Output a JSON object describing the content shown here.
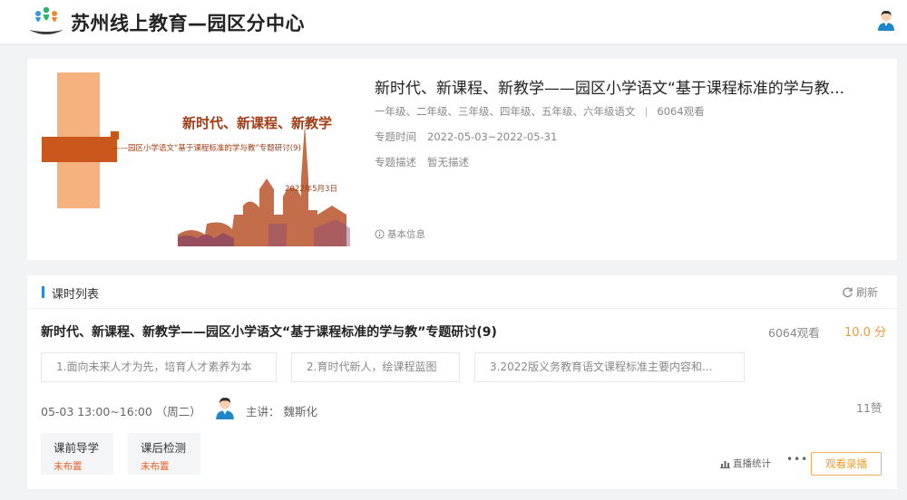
{
  "header": {
    "site_title": "苏州线上教育—园区分中心"
  },
  "topic": {
    "banner": {
      "title": "新时代、新课程、新教学",
      "subtitle": "——园区小学语文“基于课程标准的学与教”专题研讨(9)",
      "date": "2022年5月3日"
    },
    "title": "新时代、新课程、新教学——园区小学语文“基于课程标准的学与教...",
    "grades": "一年级、二年级、三年级、四年级、五年级、六年级语文",
    "separator": "|",
    "views": "6064观看",
    "time_label": "专题时间",
    "time_value": "2022-05-03~2022-05-31",
    "desc_label": "专题描述",
    "desc_value": "暂无描述",
    "basic_info": "基本信息"
  },
  "lesson_list": {
    "title": "课时列表",
    "refresh": "刷新",
    "lesson": {
      "title": "新时代、新课程、新教学——园区小学语文“基于课程标准的学与教”专题研讨(9)",
      "views": "6064观看",
      "score": "10.0 分",
      "chapters": [
        "1.面向未来人才为先，培育人才素养为本",
        "2.育时代新人，绘课程蓝图",
        "3.2022版义务教育语文课程标准主要内容和..."
      ],
      "time": "05-03 13:00~16:00 （周二）",
      "teacher": "主讲：  魏斯化",
      "likes": "11赞",
      "tasks": [
        {
          "name": "课前导学",
          "status": "未布置"
        },
        {
          "name": "课后检测",
          "status": "未布置"
        }
      ],
      "live_stats": "直播统计",
      "more": "•••",
      "watch_button": "观看录播"
    }
  },
  "colors": {
    "accent_blue": "#2a8bd8",
    "accent_orange": "#f39b2c",
    "status_red": "#e8612c",
    "banner_brown": "#a23c12"
  }
}
